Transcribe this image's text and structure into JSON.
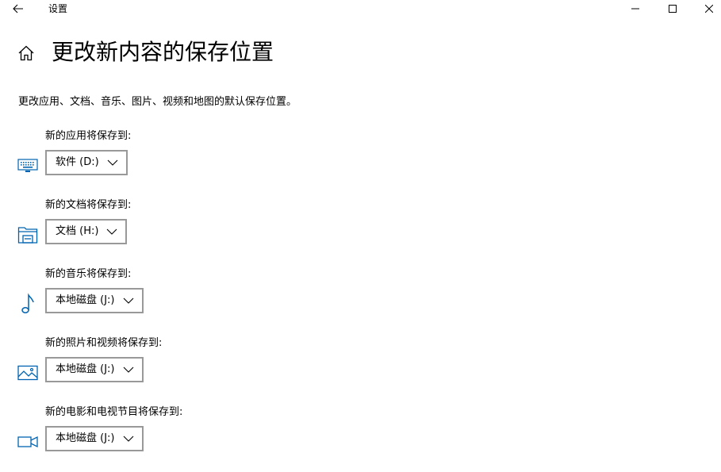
{
  "window": {
    "title": "设置"
  },
  "page": {
    "title": "更改新内容的保存位置",
    "description": "更改应用、文档、音乐、图片、视频和地图的默认保存位置。"
  },
  "sections": [
    {
      "label": "新的应用将保存到:",
      "selected": "软件 (D:)",
      "icon": "keyboard-icon"
    },
    {
      "label": "新的文档将保存到:",
      "selected": "文档 (H:)",
      "icon": "folder-icon"
    },
    {
      "label": "新的音乐将保存到:",
      "selected": "本地磁盘 (J:)",
      "icon": "music-note-icon"
    },
    {
      "label": "新的照片和视频将保存到:",
      "selected": "本地磁盘 (J:)",
      "icon": "picture-icon"
    },
    {
      "label": "新的电影和电视节目将保存到:",
      "selected": "本地磁盘 (J:)",
      "icon": "video-camera-icon"
    }
  ],
  "colors": {
    "accent": "#0063b1",
    "dropdown_border": "#999999"
  }
}
